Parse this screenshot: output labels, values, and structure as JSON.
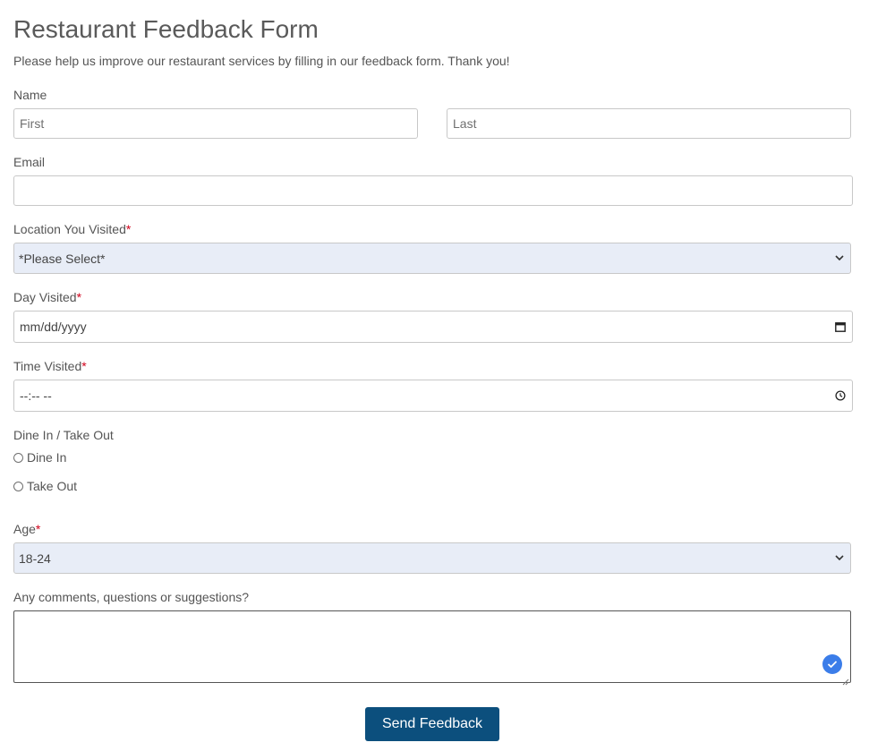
{
  "form": {
    "title": "Restaurant Feedback Form",
    "subtitle": "Please help us improve our restaurant services by filling in our feedback form. Thank you!",
    "required_mark": "*",
    "required_color": "#d0021b",
    "accent_color": "#0c4f7d"
  },
  "name": {
    "label": "Name",
    "first_placeholder": "First",
    "last_placeholder": "Last"
  },
  "email": {
    "label": "Email",
    "value": ""
  },
  "location": {
    "label": "Location You Visited",
    "selected": "*Please Select*",
    "icon": "chevron-down-icon"
  },
  "day": {
    "label": "Day Visited",
    "value": "mm/dd/yyyy",
    "icon": "calendar-icon"
  },
  "time": {
    "label": "Time Visited",
    "value": "--:-- --",
    "icon": "clock-icon"
  },
  "dine": {
    "label": "Dine In / Take Out",
    "options": [
      "Dine In",
      "Take Out"
    ]
  },
  "age": {
    "label": "Age",
    "selected": "18-24",
    "icon": "chevron-down-icon"
  },
  "comments": {
    "label": "Any comments, questions or suggestions?",
    "value": "",
    "badge_icon": "checkmark-icon"
  },
  "submit": {
    "label": "Send Feedback"
  }
}
